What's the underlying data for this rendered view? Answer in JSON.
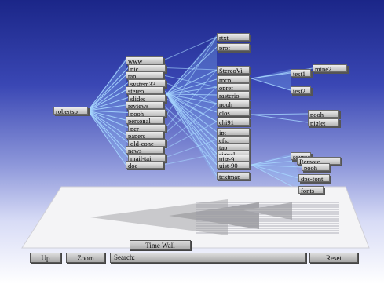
{
  "root": {
    "label": "robertso"
  },
  "level1": [
    "www",
    "nic",
    "tap",
    "system33",
    "stereo",
    "slides",
    "reviews",
    "pooh",
    "personal",
    "per",
    "papers",
    "old-cone",
    "news",
    "mail-tai",
    "doc"
  ],
  "level2": [
    "rtxt",
    "prof",
    "StereoVi",
    "rpcp",
    "opref",
    "rasterio",
    "nooh",
    "clos.",
    "chi91",
    "ipt",
    "cfs.",
    "tap",
    "signal",
    "uist-91",
    "uist-90",
    "textmap"
  ],
  "level3": [
    "mine2",
    "test1",
    "test2",
    "pooh",
    "piglet",
    "sources",
    "Remote",
    "pooh",
    "dps-font",
    "fonts"
  ],
  "floor": {
    "title": "Time Wall"
  },
  "toolbar": {
    "up_label": "Up",
    "zoom_label": "Zoom",
    "search_label": "Search:",
    "search_value": "",
    "reset_label": "Reset"
  }
}
